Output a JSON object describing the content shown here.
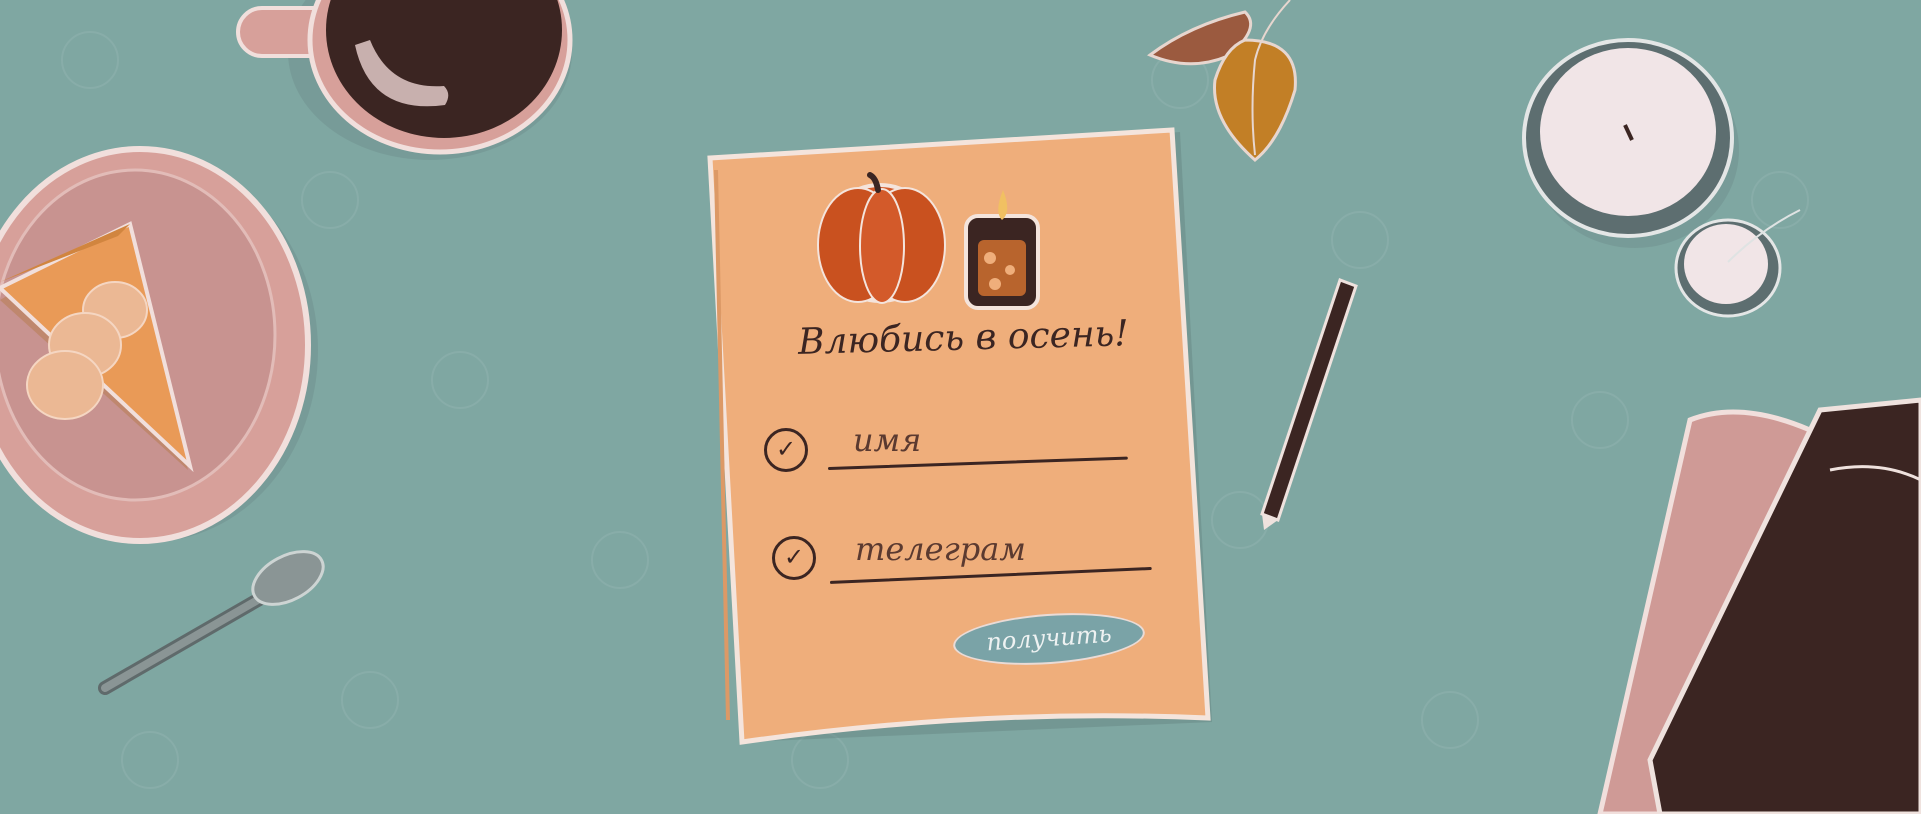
{
  "form": {
    "title": "Влюбись в осень!",
    "fields": [
      {
        "label": "имя"
      },
      {
        "label": "телеграм"
      }
    ],
    "submit_label": "получить"
  },
  "colors": {
    "background": "#7fa7a2",
    "paper": "#efae7b",
    "ink": "#3b2522",
    "button": "#7aa3a7",
    "pumpkin": "#d35a2a"
  },
  "icons": [
    "coffee-cup-icon",
    "cake-plate-icon",
    "spoon-icon",
    "leaf-icon",
    "pumpkin-icon",
    "candle-icon",
    "pencil-icon",
    "book-icon"
  ]
}
